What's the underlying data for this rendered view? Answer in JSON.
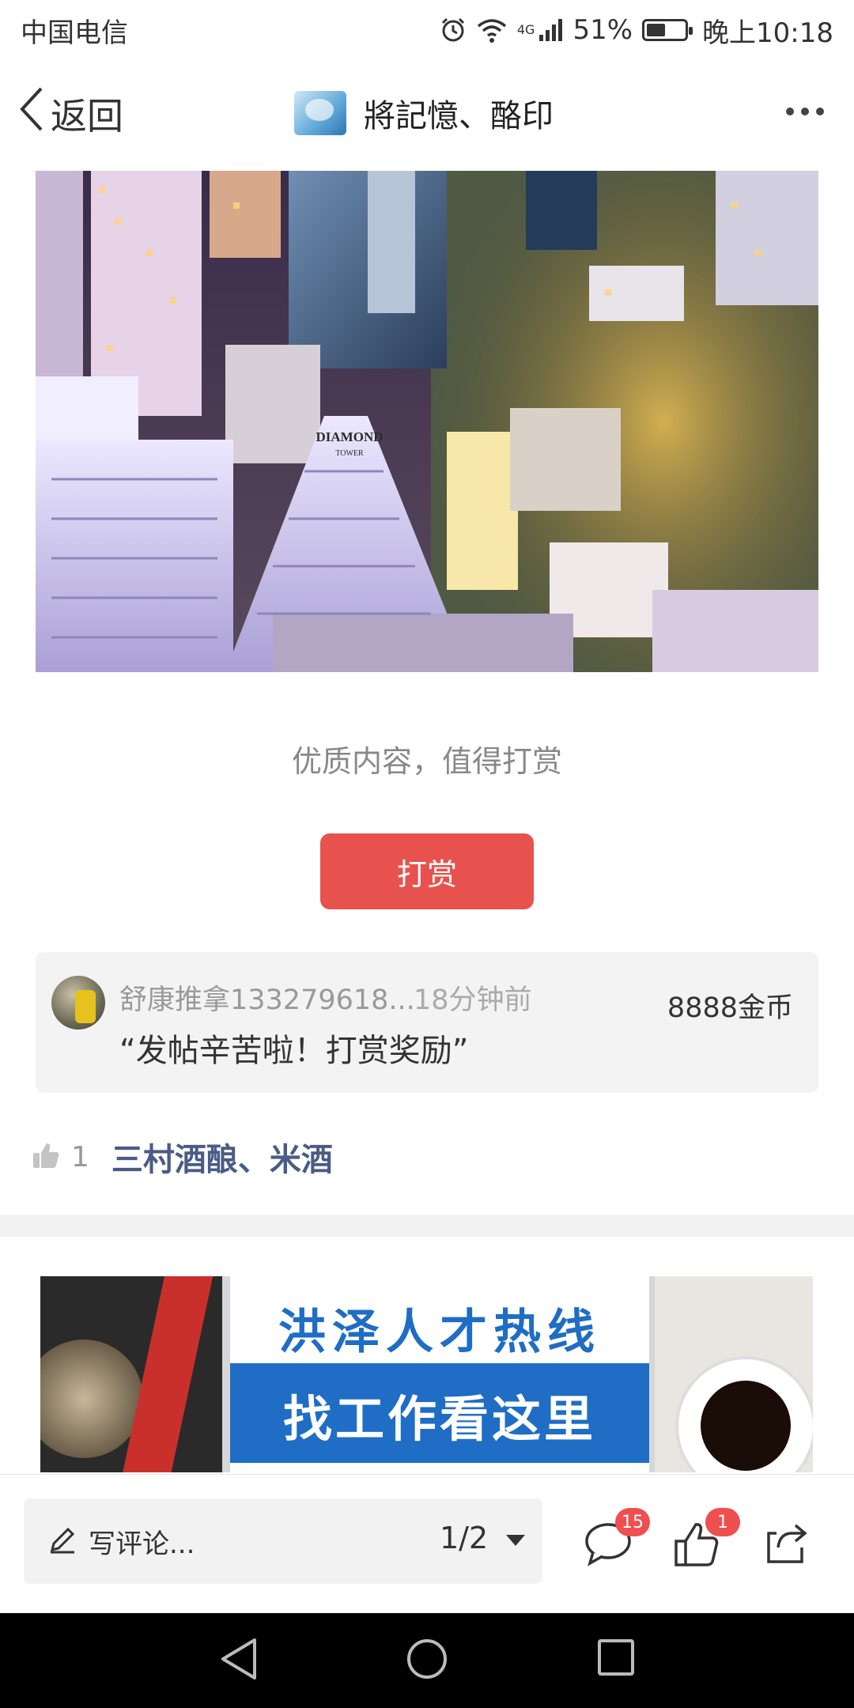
{
  "status_bar": {
    "carrier": "中国电信",
    "network": "4G",
    "battery": "51%",
    "battery_level": 0.51,
    "time": "晚上10:18"
  },
  "header": {
    "back_label": "返回",
    "title": "將記憶、酪印"
  },
  "hero": {
    "building_sign_1": "DIAMOND",
    "building_sign_2": "TOWER"
  },
  "reward": {
    "prompt": "优质内容，值得打赏",
    "button_label": "打赏",
    "record": {
      "user": "舒康推拿133279618...",
      "time": "18分钟前",
      "amount": "8888金币",
      "message": "“发帖辛苦啦！打赏奖励”"
    }
  },
  "likes": {
    "count": "1",
    "likers": "三村酒酿、米酒"
  },
  "ad": {
    "line1": "洪泽人才热线",
    "line2": "找工作看这里"
  },
  "bottom_bar": {
    "comment_placeholder": "写评论...",
    "page_indicator": "1/2",
    "comment_count": "15",
    "like_count": "1"
  },
  "colors": {
    "accent_red": "#e8524e",
    "badge_red": "#ef4f4f",
    "liker_blue": "#4a5c85"
  }
}
